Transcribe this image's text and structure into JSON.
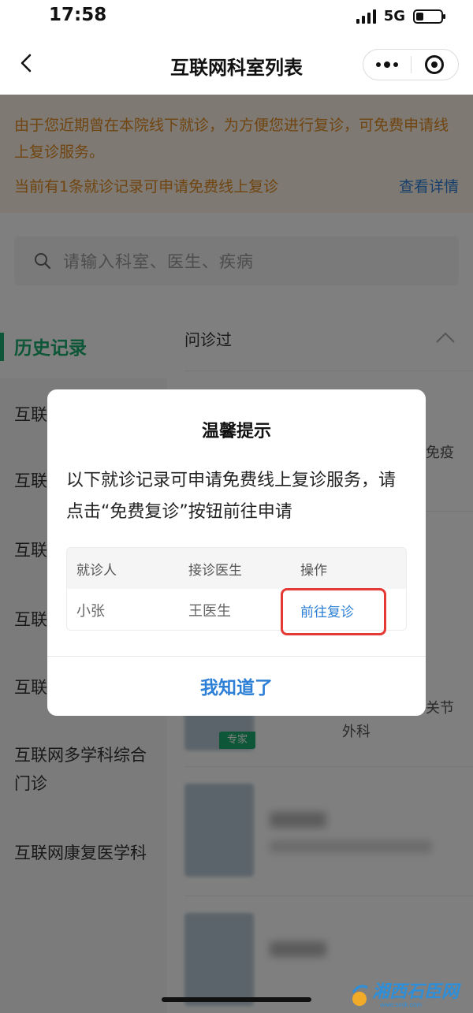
{
  "status_bar": {
    "time": "17:58",
    "network": "5G",
    "battery_level": 0.3
  },
  "nav": {
    "title": "互联网科室列表",
    "back_icon": "chevron-left-icon",
    "more_icon": "more-dots-icon",
    "close_icon": "target-circle-icon"
  },
  "notice": {
    "message": "由于您近期曾在本院线下就诊，为方便您进行复诊，可免费申请线上复诊服务。",
    "count_text": "当前有1条就诊记录可申请免费线上复诊",
    "detail_link": "查看详情"
  },
  "search": {
    "placeholder": "请输入科室、医生、疾病"
  },
  "sidebar": {
    "active_label": "历史记录",
    "items": [
      "互联",
      "互联",
      "互联",
      "互联",
      "互联",
      "互联网多学科综合门诊",
      "互联网康复医学科"
    ]
  },
  "list": {
    "section_header": "问诊过",
    "peek_1": "免疫",
    "peek_2": "关节",
    "peek_3": "外科",
    "badge": "专家"
  },
  "modal": {
    "title": "温馨提示",
    "body": "以下就诊记录可申请免费线上复诊服务，请点击“免费复诊”按钮前往申请",
    "table": {
      "headers": [
        "就诊人",
        "接诊医生",
        "操作"
      ],
      "row": {
        "patient": "小张",
        "doctor": "王医生",
        "action": "前往复诊"
      }
    },
    "confirm": "我知道了"
  },
  "watermark": {
    "text": "湘西石臣网",
    "sub": "www.sxrjk.com"
  },
  "colors": {
    "accent_green": "#1aad6e",
    "link_blue": "#2c7fd6",
    "notice_orange": "#e08a22",
    "highlight_red": "#e53935"
  }
}
